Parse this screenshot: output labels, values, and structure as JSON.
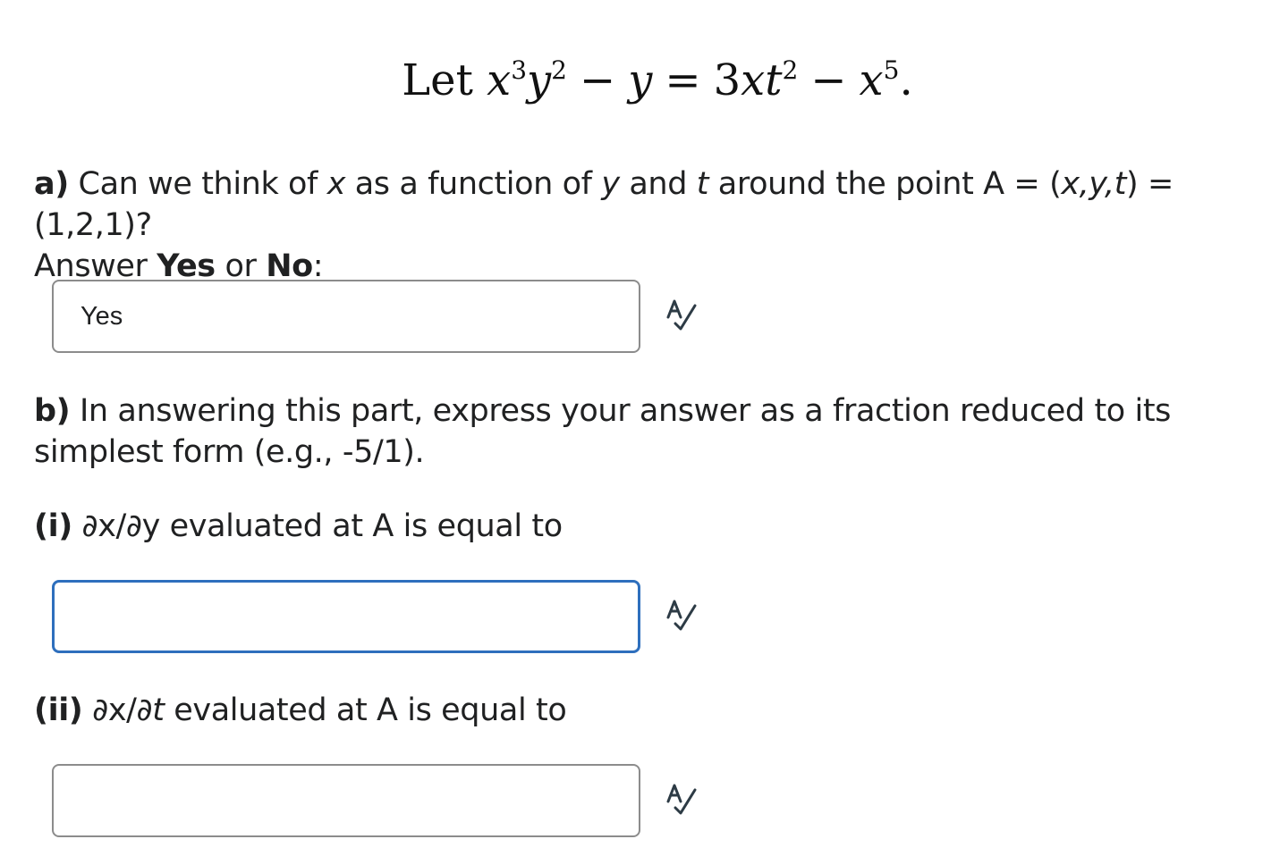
{
  "equation": {
    "prefix": "Let",
    "t1_var": "x",
    "t1_exp": "3",
    "t2_var": "y",
    "t2_exp": "2",
    "minus1": "−",
    "t3_var": "y",
    "equals": "=",
    "coef": "3",
    "t4_var1": "x",
    "t4_var2": "t",
    "t4_exp": "2",
    "minus2": "−",
    "t5_var": "x",
    "t5_exp": "5",
    "period": "."
  },
  "part_a": {
    "label": "a)",
    "text_1": " Can we think of ",
    "var_x": "x",
    "text_2": " as a function of ",
    "var_y": "y",
    "text_3": " and ",
    "var_t": "t",
    "text_4": " around the point A = (",
    "point_vars": "x,y,t",
    "text_5": ") = (1,2,1)?",
    "line2_prefix": "Answer ",
    "yes": "Yes",
    "or": " or ",
    "no": "No",
    "colon": ":",
    "answer_value": "Yes"
  },
  "part_b": {
    "label": "b)",
    "text": " In answering this part, express your answer as a fraction reduced to its simplest form (e.g., -5/1)."
  },
  "part_i": {
    "label": "(i)",
    "text": " ∂x/∂y evaluated at A is equal to",
    "answer_value": ""
  },
  "part_ii": {
    "label": "(ii)",
    "text_1": " ∂x/∂",
    "var_t": "t",
    "text_2": " evaluated at A is equal to",
    "answer_value": ""
  },
  "icons": {
    "spell_check": "spell-check-icon",
    "icon_color": "#2d3b45"
  },
  "colors": {
    "focus_border": "#2e6fbd",
    "box_border": "#8c8c8c"
  }
}
